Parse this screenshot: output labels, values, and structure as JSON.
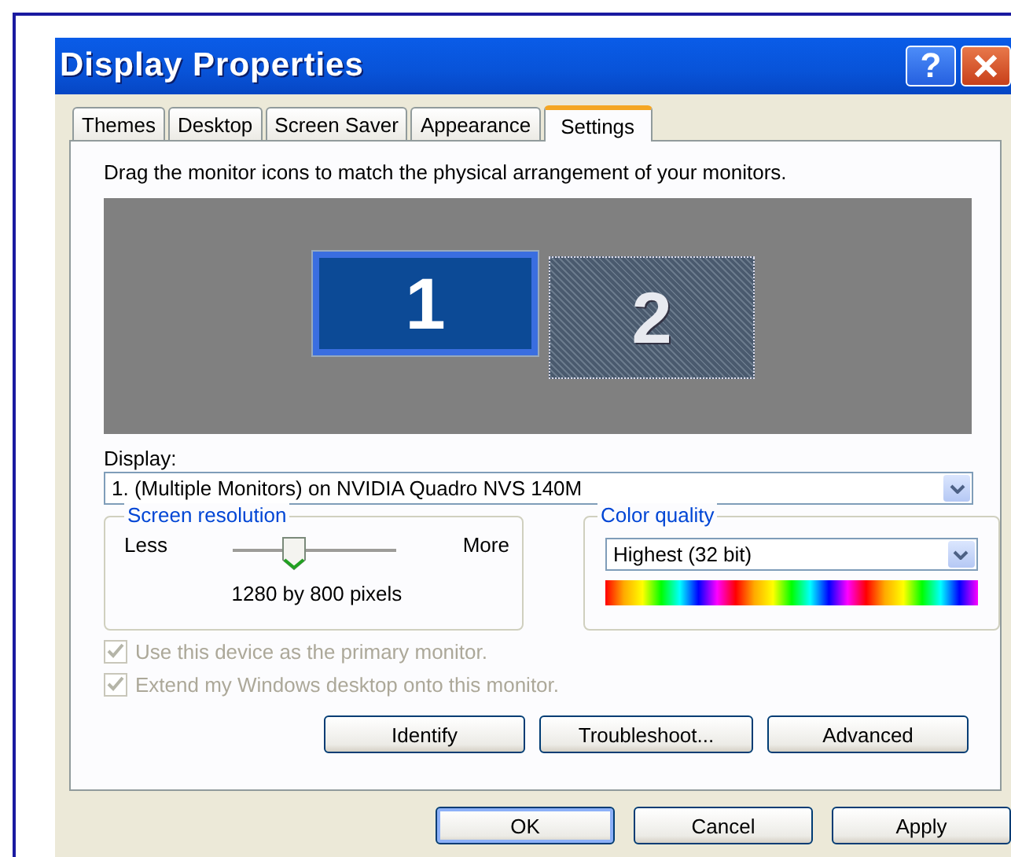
{
  "window": {
    "title": "Display Properties",
    "controls": [
      {
        "kind": "help",
        "label": "?"
      },
      {
        "kind": "close"
      }
    ]
  },
  "tabs": [
    {
      "label": "Themes",
      "selected": false
    },
    {
      "label": "Desktop",
      "selected": false
    },
    {
      "label": "Screen Saver",
      "selected": false
    },
    {
      "label": "Appearance",
      "selected": false
    },
    {
      "label": "Settings",
      "selected": true
    }
  ],
  "instruction": "Drag the monitor icons to match the physical arrangement of your monitors.",
  "monitors": [
    {
      "label": "1",
      "selected": true
    },
    {
      "label": "2",
      "selected": false
    }
  ],
  "display": {
    "label": "Display:",
    "value": "1. (Multiple Monitors) on NVIDIA Quadro NVS 140M"
  },
  "screen_resolution": {
    "title": "Screen resolution",
    "less": "Less",
    "more": "More",
    "level": 0.37,
    "reading": "1280 by 800 pixels"
  },
  "color_quality": {
    "title": "Color quality",
    "value": "Highest (32 bit)"
  },
  "checkboxes": [
    {
      "label": "Use this device as the primary monitor.",
      "checked": true,
      "disabled": true
    },
    {
      "label": "Extend my Windows desktop onto this monitor.",
      "checked": true,
      "disabled": true
    }
  ],
  "panel_buttons": [
    "Identify",
    "Troubleshoot...",
    "Advanced"
  ],
  "dialog_buttons": [
    {
      "label": "OK",
      "default": true
    },
    {
      "label": "Cancel",
      "default": false
    },
    {
      "label": "Apply",
      "default": false
    }
  ]
}
